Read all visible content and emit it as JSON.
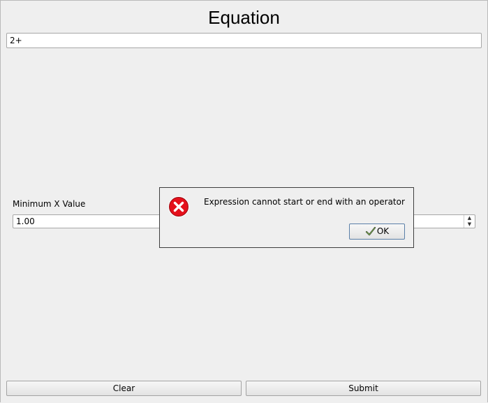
{
  "window": {
    "title": "Equation"
  },
  "equation": {
    "value": "2+"
  },
  "min_x": {
    "label": "Minimum X Value",
    "value": "1.00"
  },
  "max_x": {
    "value": ""
  },
  "buttons": {
    "clear": "Clear",
    "submit": "Submit"
  },
  "dialog": {
    "icon": "error-icon",
    "message": "Expression cannot start or end with an operator",
    "ok_label": "OK",
    "ok_icon": "checkmark-icon"
  },
  "colors": {
    "error_red": "#e4101b",
    "dialog_border": "#3e3e3e",
    "background": "#efefef"
  }
}
